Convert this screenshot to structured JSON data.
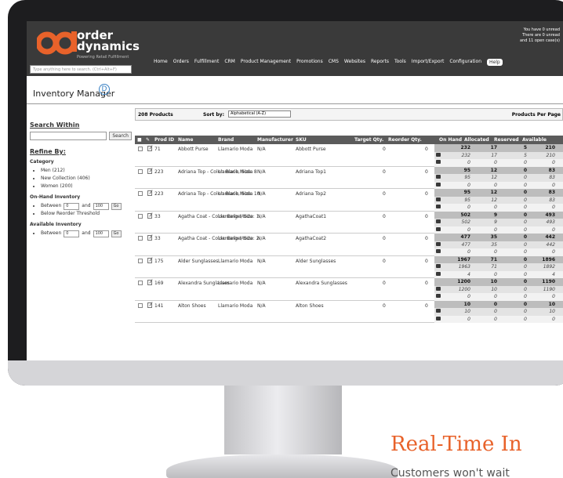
{
  "header": {
    "logo_line1": "order",
    "logo_line2": "dynamics",
    "logo_tagline": "Powering Retail Fulfillment",
    "search_placeholder": "Type anything here to search. (Ctrl+Alt+F)",
    "notice_line1": "You have 0 unread",
    "notice_line2": "There are 0 unread",
    "notice_line3": "and 11 open case(s)",
    "nav": [
      "Home",
      "Orders",
      "Fulfillment",
      "CRM",
      "Product Management",
      "Promotions",
      "CMS",
      "Websites",
      "Reports",
      "Tools",
      "Import/Export",
      "Configuration",
      "Help"
    ]
  },
  "page": {
    "title": "Inventory Manager"
  },
  "left_panel": {
    "search_heading": "Search Within",
    "search_button": "Search",
    "refine_heading": "Refine By:",
    "category_label": "Category",
    "categories": [
      "Men (212)",
      "New Collection (406)",
      "Women (200)"
    ],
    "onhand_label": "On-Hand Inventory",
    "between": "Between",
    "and": "and",
    "from_value": "0",
    "to_value": "100",
    "go": "Go",
    "below_reorder": "Below Reorder Threshold",
    "available_label": "Available Inventory"
  },
  "grid": {
    "product_count": "208 Products",
    "sort_label": "Sort by:",
    "sort_value": "Alphabetical (A-Z)",
    "per_page_label": "Products Per Page",
    "columns": [
      "Prod ID",
      "Name",
      "Brand",
      "Manufacturer",
      "SKU",
      "Target Qty.",
      "Reorder Qty.",
      "On Hand",
      "Allocated",
      "Reserved",
      "Available"
    ],
    "rows": [
      {
        "id": "71",
        "name": "Abbott Purse",
        "brand": "Llamario Moda",
        "mfr": "N/A",
        "sku": "Abbott Purse",
        "target": "0",
        "reorder": "0",
        "inv": [
          [
            "232",
            "17",
            "5",
            "210"
          ],
          [
            "232",
            "17",
            "5",
            "210"
          ],
          [
            "0",
            "0",
            "0",
            "0"
          ]
        ]
      },
      {
        "id": "223",
        "name": "Adriana Top - Color: Black, Size: 8",
        "brand": "Llamario Moda",
        "mfr": "N/A",
        "sku": "Adriana Top1",
        "target": "0",
        "reorder": "0",
        "inv": [
          [
            "95",
            "12",
            "0",
            "83"
          ],
          [
            "95",
            "12",
            "0",
            "83"
          ],
          [
            "0",
            "0",
            "0",
            "0"
          ]
        ]
      },
      {
        "id": "223",
        "name": "Adriana Top - Color: Black, Size: 10",
        "brand": "Llamario Moda",
        "mfr": "N/A",
        "sku": "Adriana Top2",
        "target": "0",
        "reorder": "0",
        "inv": [
          [
            "95",
            "12",
            "0",
            "83"
          ],
          [
            "95",
            "12",
            "0",
            "83"
          ],
          [
            "0",
            "0",
            "0",
            "0"
          ]
        ]
      },
      {
        "id": "33",
        "name": "Agatha Coat - Color: Beige, Size: 1",
        "brand": "Llamario Moda",
        "mfr": "N/A",
        "sku": "AgathaCoat1",
        "target": "0",
        "reorder": "0",
        "inv": [
          [
            "502",
            "9",
            "0",
            "493"
          ],
          [
            "502",
            "9",
            "0",
            "493"
          ],
          [
            "0",
            "0",
            "0",
            "0"
          ]
        ]
      },
      {
        "id": "33",
        "name": "Agatha Coat - Color: Beige, Size: 2",
        "brand": "Llamario Moda",
        "mfr": "N/A",
        "sku": "AgathaCoat2",
        "target": "0",
        "reorder": "0",
        "inv": [
          [
            "477",
            "35",
            "0",
            "442"
          ],
          [
            "477",
            "35",
            "0",
            "442"
          ],
          [
            "0",
            "0",
            "0",
            "0"
          ]
        ]
      },
      {
        "id": "175",
        "name": "Alder Sunglasses",
        "brand": "Llamario Moda",
        "mfr": "N/A",
        "sku": "Alder Sunglasses",
        "target": "0",
        "reorder": "0",
        "inv": [
          [
            "1967",
            "71",
            "0",
            "1896"
          ],
          [
            "1963",
            "71",
            "0",
            "1892"
          ],
          [
            "4",
            "0",
            "0",
            "4"
          ]
        ]
      },
      {
        "id": "169",
        "name": "Alexandra Sunglasses",
        "brand": "Llamario Moda",
        "mfr": "N/A",
        "sku": "Alexandra Sunglasses",
        "target": "0",
        "reorder": "0",
        "inv": [
          [
            "1200",
            "10",
            "0",
            "1190"
          ],
          [
            "1200",
            "10",
            "0",
            "1190"
          ],
          [
            "0",
            "0",
            "0",
            "0"
          ]
        ]
      },
      {
        "id": "141",
        "name": "Alton Shoes",
        "brand": "Llamario Moda",
        "mfr": "N/A",
        "sku": "Alton Shoes",
        "target": "0",
        "reorder": "0",
        "inv": [
          [
            "10",
            "0",
            "0",
            "10"
          ],
          [
            "10",
            "0",
            "0",
            "10"
          ],
          [
            "0",
            "0",
            "0",
            "0"
          ]
        ]
      }
    ]
  },
  "promo": {
    "heading": "Real-Time In",
    "text": "Customers won't wait"
  },
  "colors": {
    "accent": "#e8622a",
    "header_bg": "#3a3a3a",
    "column_header_bg": "#5b5b5b"
  }
}
